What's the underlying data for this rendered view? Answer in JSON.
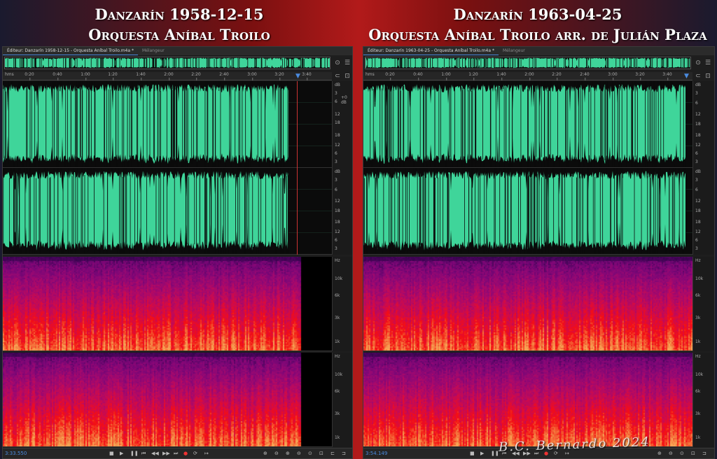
{
  "titles": {
    "left": {
      "line1": "Danzarín 1958-12-15",
      "line2": "Orquesta Aníbal Troilo"
    },
    "right": {
      "line1": "Danzarín 1963-04-25",
      "line2": "Orquesta Aníbal Troilo arr. de Julián Plaza"
    }
  },
  "panels": {
    "left": {
      "tab_active": "Éditeur: Danzarín 1958-12-15 - Orquesta Aníbal Troilo.m4a *",
      "tab_inactive": "Mélangeur",
      "ruler_unit": "hms",
      "ruler_ticks": [
        "0:20",
        "0:40",
        "1:00",
        "1:20",
        "1:40",
        "2:00",
        "2:20",
        "2:40",
        "3:00",
        "3:20",
        "3:40"
      ],
      "db_labels_top": [
        "dB",
        "3",
        "6",
        "+0 dB",
        "12",
        "18",
        "18",
        "12",
        "6",
        "3"
      ],
      "db_labels_bottom": [
        "dB",
        "3",
        "6",
        "12",
        "18",
        "18",
        "12",
        "6",
        "3"
      ],
      "hz_labels": [
        "Hz",
        "10k",
        "6k",
        "3k",
        "1k"
      ],
      "time_display": "3:33.550",
      "duration_fraction": 0.87
    },
    "right": {
      "tab_active": "Éditeur: Danzarín 1963-04-25 - Orquesta Aníbal Troilo.m4a *",
      "tab_inactive": "Mélangeur",
      "ruler_unit": "hms",
      "ruler_ticks": [
        "0:20",
        "0:40",
        "1:00",
        "1:20",
        "1:40",
        "2:00",
        "2:20",
        "2:40",
        "3:00",
        "3:20",
        "3:40"
      ],
      "db_labels_top": [
        "dB",
        "3",
        "6",
        "12",
        "18",
        "18",
        "12",
        "6",
        "3"
      ],
      "db_labels_bottom": [
        "dB",
        "3",
        "6",
        "12",
        "18",
        "18",
        "12",
        "6",
        "3"
      ],
      "hz_labels": [
        "Hz",
        "10k",
        "6k",
        "3k",
        "1k"
      ],
      "time_display": "3:54.149",
      "duration_fraction": 0.98
    }
  },
  "transport_buttons": [
    "stop",
    "play",
    "pause",
    "goto-start",
    "rewind",
    "fast-forward",
    "goto-end",
    "record",
    "loop",
    "skip"
  ],
  "signature": "B.C. Bernardo 2024",
  "colors": {
    "waveform": "#3fd59a",
    "waveform_bg": "#0b0b0b",
    "accent": "#4a8bdf",
    "playhead": "#cc3333"
  }
}
